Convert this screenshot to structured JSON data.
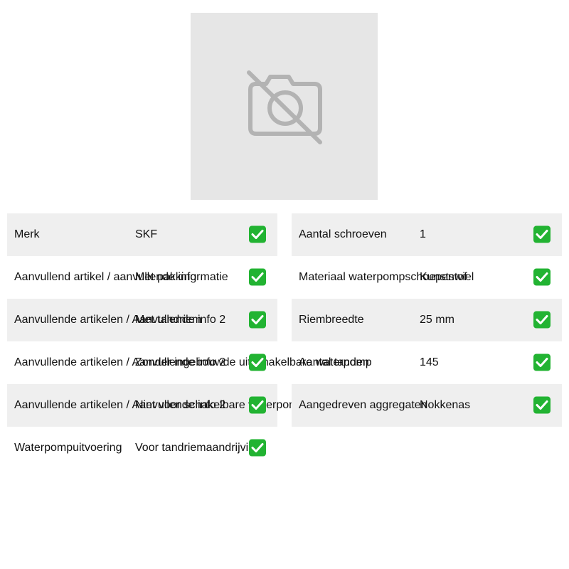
{
  "product": {
    "image_icon": "camera-off-icon"
  },
  "check_icon": "check-box-icon",
  "colors": {
    "check": "#22b332",
    "row_shade": "#efefef",
    "placeholder_bg": "#e6e6e6"
  },
  "specs_left": [
    {
      "label": "Merk",
      "value": "SKF"
    },
    {
      "label": "Aanvullend artikel / aanvullende informatie",
      "value": "Met pakking"
    },
    {
      "label": "Aanvullende artikelen / Aanvullende info 2",
      "value": "Met tandriem"
    },
    {
      "label": "Aanvullende artikelen / Aanvullende info 2",
      "value": "Zonder ingebouwde uitschakelbare waterpomp"
    },
    {
      "label": "Aanvullende artikelen / Aanvullende info 2",
      "value": "Niet voor schakelbare waterpomp"
    },
    {
      "label": "Waterpompuitvoering",
      "value": "Voor tandriemaandrijving"
    }
  ],
  "specs_right": [
    {
      "label": "Aantal schroeven",
      "value": "1"
    },
    {
      "label": "Materiaal waterpompschoepenwiel",
      "value": "Kunststof"
    },
    {
      "label": "Riembreedte",
      "value": "25 mm"
    },
    {
      "label": "Aantal tanden",
      "value": "145"
    },
    {
      "label": "Aangedreven aggregaten",
      "value": "Nokkenas"
    }
  ]
}
